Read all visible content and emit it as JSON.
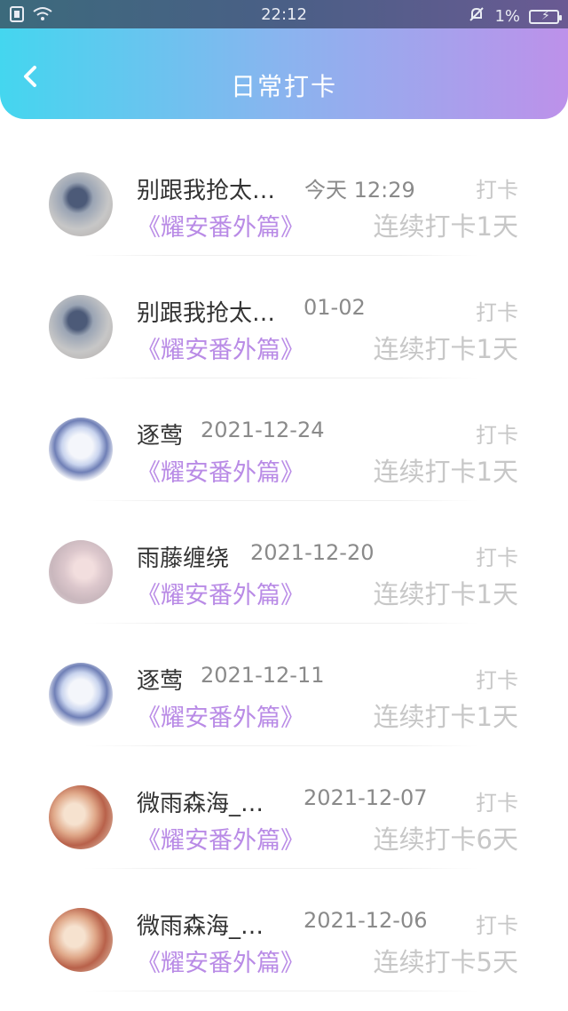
{
  "status_bar": {
    "time": "22:12",
    "battery_percent": "1%",
    "icons": [
      "sim-icon",
      "wifi-icon",
      "mute-bell-icon",
      "battery-charging-icon"
    ]
  },
  "header": {
    "title": "日常打卡",
    "back_icon": "chevron-left-icon"
  },
  "colors": {
    "accent_purple": "#b98be6",
    "header_start": "#44d6ef",
    "header_end": "#bd91ea"
  },
  "entries": [
    {
      "name": "别跟我抢太…",
      "time": "今天 12:29",
      "book": "《耀安番外篇》",
      "action": "打卡",
      "streak": "连续打卡1天"
    },
    {
      "name": "别跟我抢太…",
      "time": "01-02",
      "book": "《耀安番外篇》",
      "action": "打卡",
      "streak": "连续打卡1天"
    },
    {
      "name": "逐莺",
      "time": "2021-12-24",
      "book": "《耀安番外篇》",
      "action": "打卡",
      "streak": "连续打卡1天"
    },
    {
      "name": "雨藤缠绕",
      "time": "2021-12-20",
      "book": "《耀安番外篇》",
      "action": "打卡",
      "streak": "连续打卡1天"
    },
    {
      "name": "逐莺",
      "time": "2021-12-11",
      "book": "《耀安番外篇》",
      "action": "打卡",
      "streak": "连续打卡1天"
    },
    {
      "name": "微雨森海_…",
      "time": "2021-12-07",
      "book": "《耀安番外篇》",
      "action": "打卡",
      "streak": "连续打卡6天"
    },
    {
      "name": "微雨森海_…",
      "time": "2021-12-06",
      "book": "《耀安番外篇》",
      "action": "打卡",
      "streak": "连续打卡5天"
    }
  ]
}
